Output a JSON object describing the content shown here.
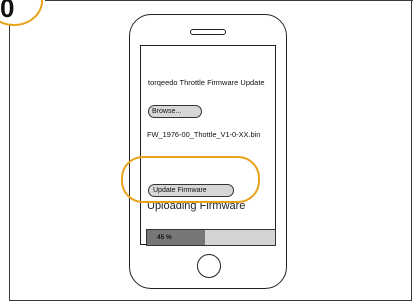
{
  "step": {
    "number": "0"
  },
  "screen": {
    "title": "torqeedo Throttle Firmware Update",
    "browse_label": "Browse...",
    "filename": "FW_1976-00_Thottle_V1-0-XX.bin",
    "update_label": "Update Firmware",
    "status": "Uploading Firmware",
    "progress": {
      "value": 0.45,
      "label": "45 %"
    }
  },
  "colors": {
    "highlight": "#e8a21a",
    "progress_fill": "#777777",
    "progress_track": "#d4d4d4"
  }
}
